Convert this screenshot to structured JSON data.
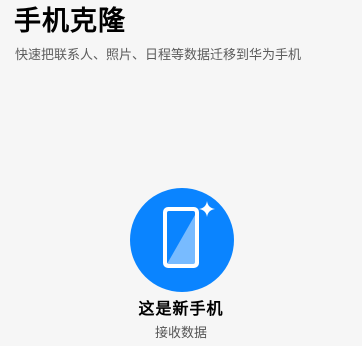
{
  "header": {
    "title": "手机克隆",
    "subtitle": "快速把联系人、照片、日程等数据迁移到华为手机"
  },
  "option": {
    "icon": "phone-sparkle-icon",
    "accent_color": "#0a84ff",
    "title": "这是新手机",
    "subtitle": "接收数据"
  }
}
